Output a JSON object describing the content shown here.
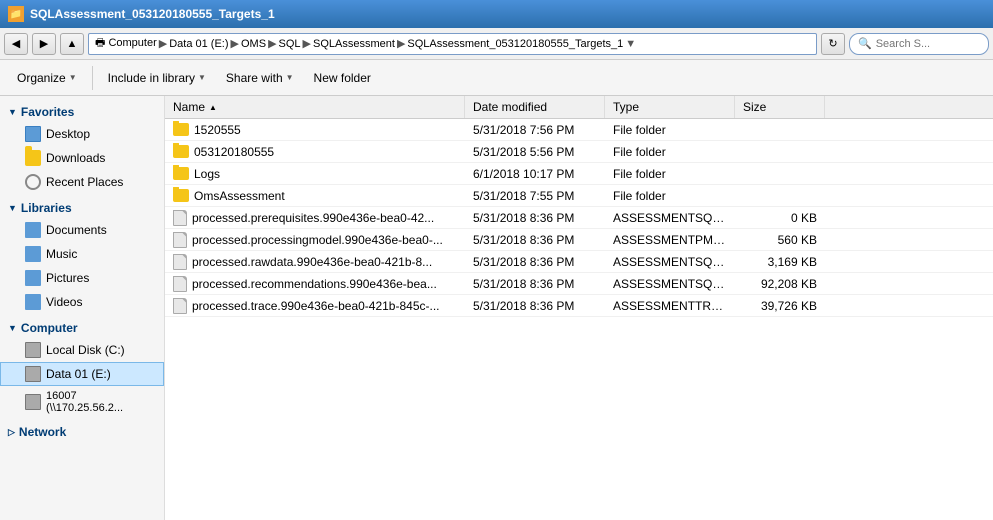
{
  "titleBar": {
    "title": "SQLAssessment_053120180555_Targets_1",
    "icon": "folder-icon"
  },
  "addressBar": {
    "pathSegments": [
      "Computer",
      "Data 01 (E:)",
      "OMS",
      "SQL",
      "SQLAssessment",
      "SQLAssessment_053120180555_Targets_1"
    ],
    "searchPlaceholder": "Search S...",
    "searchLabel": "Search"
  },
  "toolbar": {
    "organizeLabel": "Organize",
    "includeLabel": "Include in library",
    "shareLabel": "Share with",
    "newFolderLabel": "New folder"
  },
  "sidebar": {
    "favorites": {
      "header": "Favorites",
      "items": [
        {
          "label": "Desktop",
          "icon": "desktop"
        },
        {
          "label": "Downloads",
          "icon": "downloads"
        },
        {
          "label": "Recent Places",
          "icon": "recent"
        }
      ]
    },
    "libraries": {
      "header": "Libraries",
      "items": [
        {
          "label": "Documents",
          "icon": "documents"
        },
        {
          "label": "Music",
          "icon": "music"
        },
        {
          "label": "Pictures",
          "icon": "pictures"
        },
        {
          "label": "Videos",
          "icon": "videos"
        }
      ]
    },
    "computer": {
      "header": "Computer",
      "items": [
        {
          "label": "Local Disk (C:)",
          "icon": "drive"
        },
        {
          "label": "Data 01 (E:)",
          "icon": "drive",
          "active": true
        },
        {
          "label": "16007 (\\\\170.25.56.2...",
          "icon": "drive"
        }
      ]
    },
    "network": {
      "header": "Network",
      "items": []
    }
  },
  "fileList": {
    "columns": [
      {
        "label": "Name",
        "sortArrow": "▲"
      },
      {
        "label": "Date modified"
      },
      {
        "label": "Type"
      },
      {
        "label": "Size"
      }
    ],
    "rows": [
      {
        "name": "1520555",
        "type": "folder",
        "date": "5/31/2018 7:56 PM",
        "fileType": "File folder",
        "size": ""
      },
      {
        "name": "053120180555",
        "type": "folder",
        "date": "5/31/2018 5:56 PM",
        "fileType": "File folder",
        "size": ""
      },
      {
        "name": "Logs",
        "type": "folder",
        "date": "6/1/2018 10:17 PM",
        "fileType": "File folder",
        "size": ""
      },
      {
        "name": "OmsAssessment",
        "type": "folder",
        "date": "5/31/2018 7:55 PM",
        "fileType": "File folder",
        "size": ""
      },
      {
        "name": "processed.prerequisites.990e436e-bea0-42...",
        "type": "file",
        "date": "5/31/2018 8:36 PM",
        "fileType": "ASSESSMENTSQLRE...",
        "size": "0 KB"
      },
      {
        "name": "processed.processingmodel.990e436e-bea0-...",
        "type": "file",
        "date": "5/31/2018 8:36 PM",
        "fileType": "ASSESSMENTPM File",
        "size": "560 KB"
      },
      {
        "name": "processed.rawdata.990e436e-bea0-421b-8...",
        "type": "file",
        "date": "5/31/2018 8:36 PM",
        "fileType": "ASSESSMENTSQLR...",
        "size": "3,169 KB"
      },
      {
        "name": "processed.recommendations.990e436e-bea...",
        "type": "file",
        "date": "5/31/2018 8:36 PM",
        "fileType": "ASSESSMENTSQLRE...",
        "size": "92,208 KB"
      },
      {
        "name": "processed.trace.990e436e-bea0-421b-845c-...",
        "type": "file",
        "date": "5/31/2018 8:36 PM",
        "fileType": "ASSESSMENTTRAC...",
        "size": "39,726 KB"
      }
    ]
  }
}
